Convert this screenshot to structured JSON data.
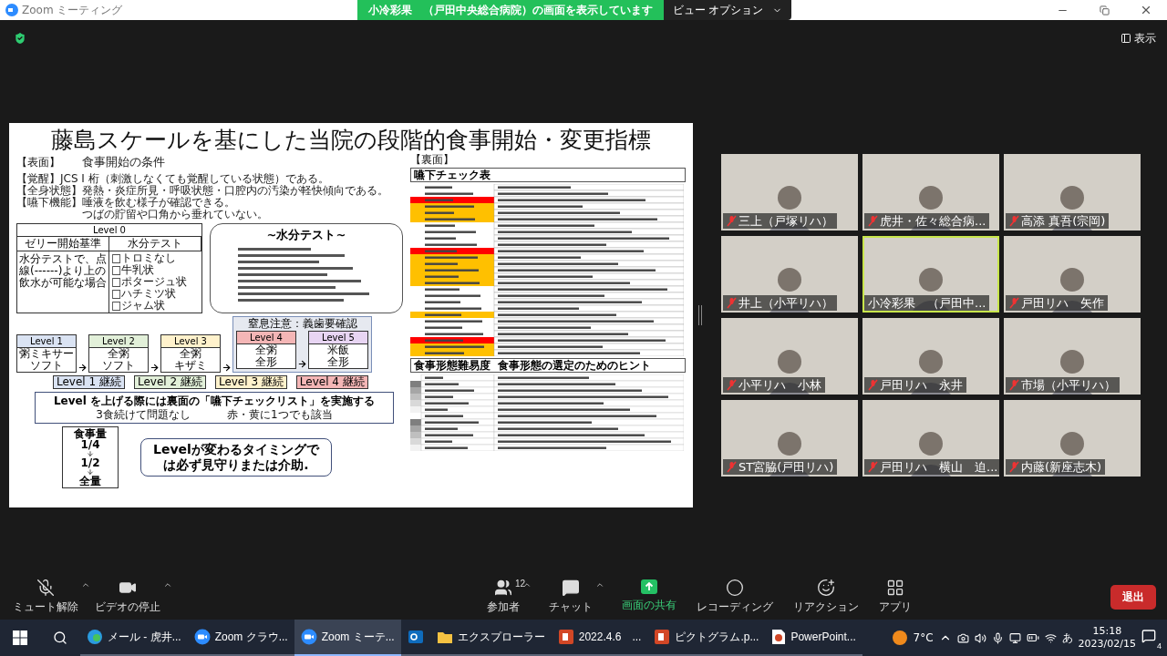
{
  "window": {
    "title": "Zoom ミーティング"
  },
  "share_banner": {
    "text": "小冷彩果　（戸田中央総合病院）の画面を表示しています",
    "view_options": "ビュー オプション"
  },
  "view_button": "表示",
  "slide": {
    "title": "藤島スケールを基にした当院の段階的食事開始・変更指標",
    "front_label": "【表面】",
    "back_label": "【裏面】",
    "conditions_heading": "食事開始の条件",
    "conditions": [
      "【覚醒】JCS I 桁（刺激しなくても覚醒している状態）である。",
      "【全身状態】発熱・炎症所見・呼吸状態・口腔内の汚染が軽快傾向である。",
      "【嚥下機能】唾液を飲む様子が確認できる。",
      "つばの貯留や口角から垂れていない。"
    ],
    "level0": {
      "title": "Level 0",
      "columns": [
        "ゼリー開始基準",
        "水分テスト"
      ],
      "criterion": "水分テストで、点線(------)より上の飲水が可能な場合",
      "checks": [
        "□トロミなし",
        "□牛乳状",
        "□ポタージュ状",
        "□ハチミツ状",
        "□ジャム状"
      ]
    },
    "water_test_title": "~水分テスト~",
    "caution_group": "窒息注意：義歯要確認",
    "levels": [
      {
        "label": "Level 1",
        "food": [
          "粥ミキサー",
          "ソフト"
        ],
        "continue": "Level 1 継続",
        "color": "#dae3f3",
        "caution": false
      },
      {
        "label": "Level 2",
        "food": [
          "全粥",
          "ソフト"
        ],
        "continue": "Level 2 継続",
        "color": "#e2f0d9",
        "caution": false
      },
      {
        "label": "Level 3",
        "food": [
          "全粥",
          "キザミ"
        ],
        "continue": "Level 3 継続",
        "color": "#fff2cc",
        "caution": false
      },
      {
        "label": "Level 4",
        "food": [
          "全粥",
          "全形"
        ],
        "continue": "Level 4 継続",
        "color": "#f4b6b6",
        "caution": true
      },
      {
        "label": "Level 5",
        "food": [
          "米飯",
          "全形"
        ],
        "color": "#e8d5f3",
        "caution": true
      }
    ],
    "upgrade_note": "Level を上げる際には裏面の「嚥下チェックリスト」を実施する",
    "upgrade_legend": [
      "3食続けて問題なし",
      "赤・黄に1つでも該当"
    ],
    "intake": {
      "title": "食事量",
      "steps": [
        "1/4",
        "1/2",
        "全量"
      ]
    },
    "timing_note": "Levelが変わるタイミングでは必ず**見守り**または**介助**.",
    "checklist": {
      "title": "嚥下チェック表",
      "rows": [
        {
          "color": "#ffffff"
        },
        {
          "color": "#ffffff"
        },
        {
          "color": "#ff0000"
        },
        {
          "color": "#ffc000"
        },
        {
          "color": "#ffc000"
        },
        {
          "color": "#ffc000"
        },
        {
          "color": "#ffffff"
        },
        {
          "color": "#ffffff"
        },
        {
          "color": "#ffffff"
        },
        {
          "color": "#ffffff"
        },
        {
          "color": "#ff0000"
        },
        {
          "color": "#ffc000"
        },
        {
          "color": "#ffc000"
        },
        {
          "color": "#ffc000"
        },
        {
          "color": "#ffc000"
        },
        {
          "color": "#ffc000"
        },
        {
          "color": "#ffffff"
        },
        {
          "color": "#ffffff"
        },
        {
          "color": "#ffffff"
        },
        {
          "color": "#ffffff"
        },
        {
          "color": "#ffc000"
        },
        {
          "color": "#ffffff"
        },
        {
          "color": "#ffffff"
        },
        {
          "color": "#ffffff"
        },
        {
          "color": "#ff0000"
        },
        {
          "color": "#ffc000"
        },
        {
          "color": "#ffc000"
        }
      ]
    },
    "food_table": {
      "columns": [
        "食事形態難易度",
        "食事形態の選定のためのヒント"
      ],
      "rows": [
        {
          "color": "#ffffff"
        },
        {
          "color": "#7f7f7f"
        },
        {
          "color": "#a6a6a6"
        },
        {
          "color": "#bfbfbf"
        },
        {
          "color": "#d9d9d9"
        },
        {
          "color": "#f2f2f2"
        },
        {
          "color": "#ffffff"
        },
        {
          "color": "#7f7f7f"
        },
        {
          "color": "#a6a6a6"
        },
        {
          "color": "#bfbfbf"
        },
        {
          "color": "#d9d9d9"
        },
        {
          "color": "#f2f2f2"
        }
      ]
    }
  },
  "participants": [
    {
      "name": "三上（戸塚リハ）",
      "muted": true,
      "active_speaker": false
    },
    {
      "name": "虎井・佐々総合病...",
      "muted": true,
      "active_speaker": false
    },
    {
      "name": "高添 真吾(宗岡)",
      "muted": true,
      "active_speaker": false
    },
    {
      "name": "井上（小平リハ）",
      "muted": true,
      "active_speaker": false
    },
    {
      "name": "小冷彩果　（戸田中...",
      "muted": false,
      "active_speaker": true
    },
    {
      "name": "戸田リハ　矢作",
      "muted": true,
      "active_speaker": false
    },
    {
      "name": "小平リハ　小林",
      "muted": true,
      "active_speaker": false
    },
    {
      "name": "戸田リハ　永井",
      "muted": true,
      "active_speaker": false
    },
    {
      "name": "市場（小平リハ）",
      "muted": true,
      "active_speaker": false
    },
    {
      "name": "ST宮脇(戸田リハ)",
      "muted": true,
      "active_speaker": false
    },
    {
      "name": "戸田リハ　横山　迫...",
      "muted": true,
      "active_speaker": false
    },
    {
      "name": "内藤(新座志木)",
      "muted": true,
      "active_speaker": false
    }
  ],
  "left_controls": [
    {
      "kind": "mic-off",
      "label": "ミュート解除",
      "caret": true
    },
    {
      "kind": "video",
      "label": "ビデオの停止",
      "caret": true
    }
  ],
  "center_controls": [
    {
      "kind": "participants",
      "label": "参加者",
      "count": "12",
      "caret": true
    },
    {
      "kind": "chat",
      "label": "チャット",
      "caret": true
    },
    {
      "kind": "share",
      "label": "画面の共有",
      "caret": false
    },
    {
      "kind": "record",
      "label": "レコーディング",
      "caret": false
    },
    {
      "kind": "reactions",
      "label": "リアクション",
      "caret": false
    },
    {
      "kind": "apps",
      "label": "アプリ",
      "caret": false
    }
  ],
  "leave_button": "退出",
  "taskbar": {
    "items": [
      {
        "kind": "edge",
        "label": "メール - 虎井...",
        "selected": false
      },
      {
        "kind": "zoom",
        "label": "Zoom クラウ...",
        "selected": false
      },
      {
        "kind": "zoom",
        "label": "Zoom ミーテ...",
        "selected": true
      },
      {
        "kind": "outlook",
        "selected": false
      },
      {
        "kind": "explorer",
        "label": "エクスプローラー",
        "selected": false
      },
      {
        "kind": "ppt",
        "label": "2022.4.6　...",
        "selected": false
      },
      {
        "kind": "ppt",
        "label": "ピクトグラム.p...",
        "selected": false
      },
      {
        "kind": "pptfile",
        "label": "PowerPoint...",
        "selected": false
      }
    ],
    "weather": "7°C",
    "ime": "あ",
    "time": "15:18",
    "date": "2023/02/15",
    "notifications": "4"
  }
}
